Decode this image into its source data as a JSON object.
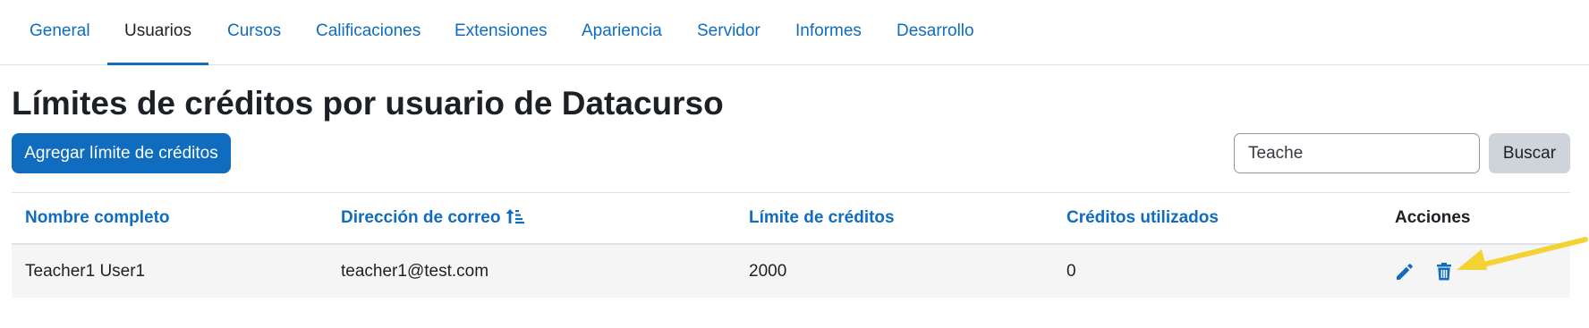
{
  "nav": {
    "tabs": [
      {
        "label": "General"
      },
      {
        "label": "Usuarios"
      },
      {
        "label": "Cursos"
      },
      {
        "label": "Calificaciones"
      },
      {
        "label": "Extensiones"
      },
      {
        "label": "Apariencia"
      },
      {
        "label": "Servidor"
      },
      {
        "label": "Informes"
      },
      {
        "label": "Desarrollo"
      }
    ],
    "active": "Usuarios"
  },
  "page": {
    "title": "Límites de créditos por usuario de Datacurso",
    "add_button_label": "Agregar límite de créditos"
  },
  "search": {
    "value": "Teache",
    "button_label": "Buscar"
  },
  "table": {
    "headers": {
      "fullname": "Nombre completo",
      "email": "Dirección de correo",
      "limit": "Límite de créditos",
      "used": "Créditos utilizados",
      "actions": "Acciones"
    },
    "sorted_column": "email",
    "sort_direction": "ascending",
    "rows": [
      {
        "fullname": "Teacher1 User1",
        "email": "teacher1@test.com",
        "limit": "2000",
        "used": "0",
        "actions": [
          "pencil-icon",
          "trash-icon"
        ]
      }
    ]
  },
  "colors": {
    "accent": "#0f6cbf",
    "annotation_arrow": "#f5d233",
    "row_background": "#f5f5f5"
  },
  "annotation": {
    "type": "arrow",
    "points_to": "trash-icon"
  }
}
